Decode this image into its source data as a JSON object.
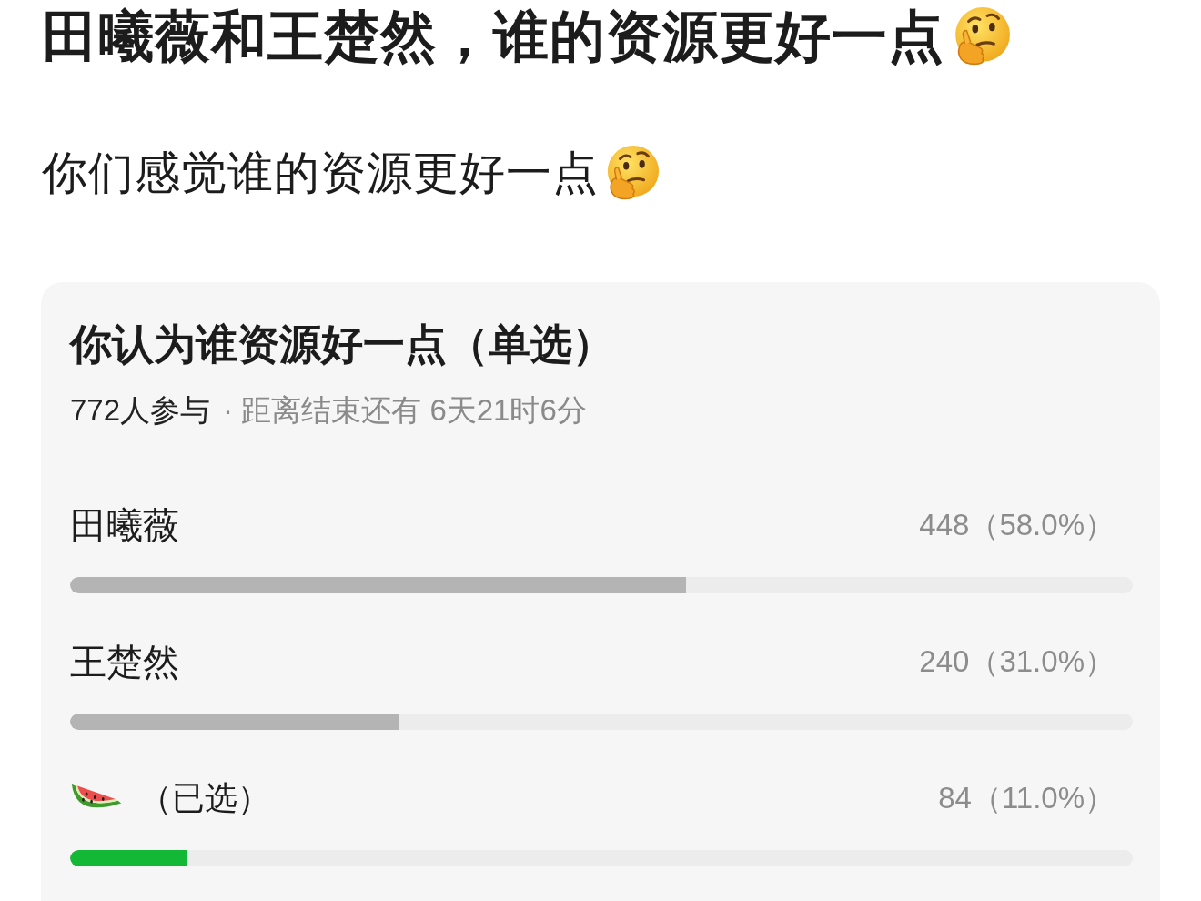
{
  "post": {
    "title": "田曦薇和王楚然，谁的资源更好一点",
    "body": "你们感觉谁的资源更好一点"
  },
  "poll": {
    "title": "你认为谁资源好一点（单选）",
    "participants": "772人参与",
    "remaining": "· 距离结束还有 6天21时6分",
    "options": [
      {
        "kind": "text",
        "label": "田曦薇",
        "selected": false,
        "result": "448（58.0%）",
        "level": 0.58
      },
      {
        "kind": "text",
        "label": "王楚然",
        "selected": false,
        "result": "240（31.0%）",
        "level": 0.31
      },
      {
        "kind": "emoji",
        "selected_note": "（已选）",
        "selected": true,
        "result": "84（11.0%）",
        "level": 0.11
      }
    ]
  }
}
